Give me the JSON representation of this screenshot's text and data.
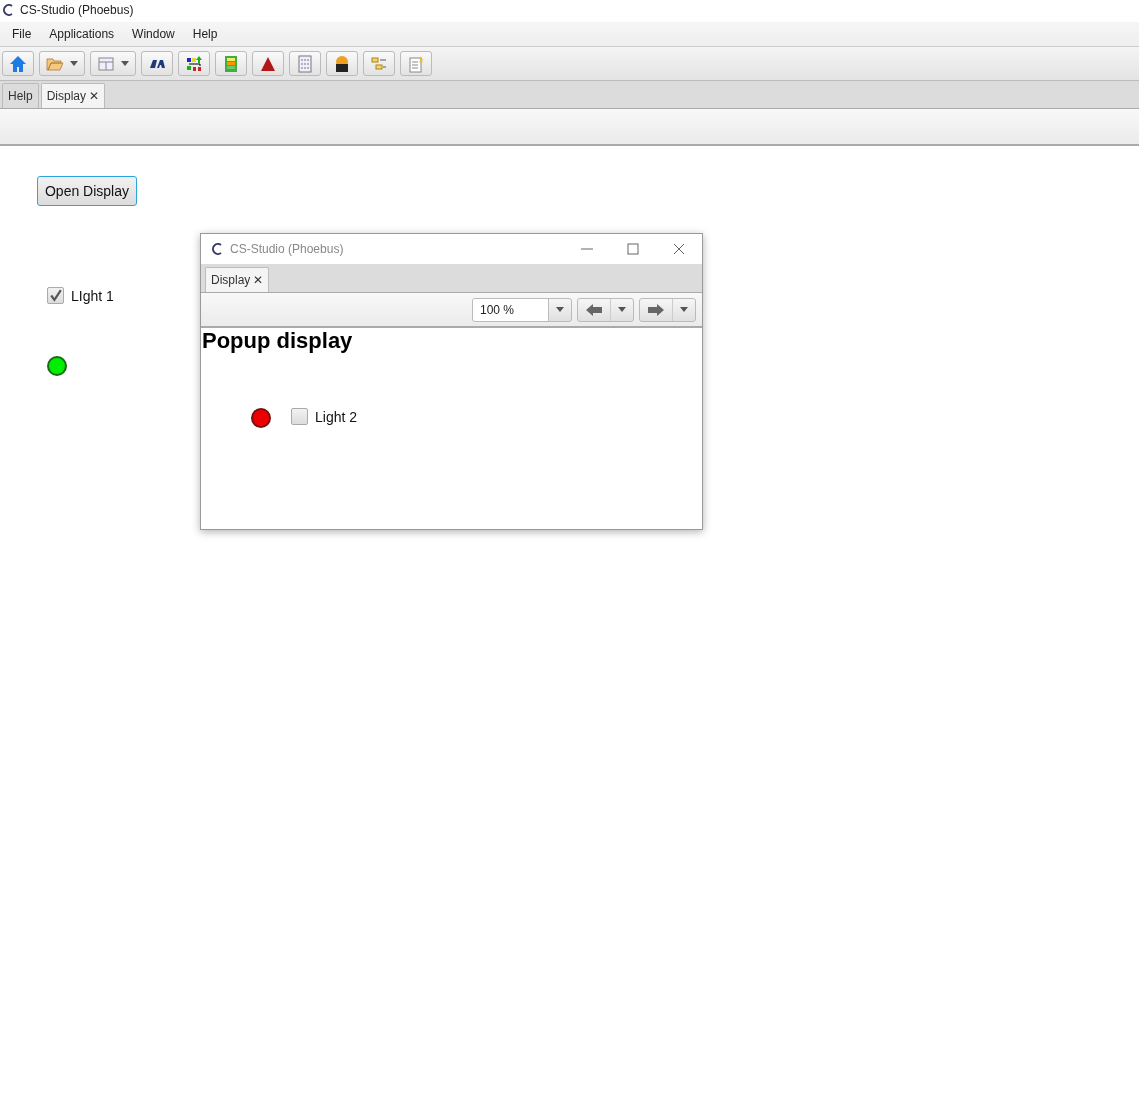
{
  "window": {
    "title": "CS-Studio (Phoebus)"
  },
  "menu": [
    "File",
    "Applications",
    "Window",
    "Help"
  ],
  "toolbar": [
    {
      "kind": "home",
      "dropdown": false
    },
    {
      "kind": "folder",
      "dropdown": true
    },
    {
      "kind": "layout",
      "dropdown": true
    },
    {
      "kind": "tia",
      "dropdown": false
    },
    {
      "kind": "network",
      "dropdown": false
    },
    {
      "kind": "table",
      "dropdown": false
    },
    {
      "kind": "triangle",
      "dropdown": false
    },
    {
      "kind": "list",
      "dropdown": false
    },
    {
      "kind": "badge",
      "dropdown": false
    },
    {
      "kind": "tree",
      "dropdown": false
    },
    {
      "kind": "note",
      "dropdown": false
    }
  ],
  "tabs": [
    {
      "label": "Help",
      "selected": false,
      "closable": false
    },
    {
      "label": "Display",
      "selected": true,
      "closable": true
    }
  ],
  "close_glyph": "✕",
  "display": {
    "button": "Open Display",
    "checkbox": {
      "label": "LIght 1",
      "checked": true
    },
    "led": {
      "on": true
    }
  },
  "popup": {
    "title": "CS-Studio (Phoebus)",
    "tab": {
      "label": "Display",
      "selected": true
    },
    "zoom": "100 %",
    "heading": "Popup display",
    "led": {
      "on": false
    },
    "checkbox": {
      "label": "Light 2",
      "checked": false
    }
  }
}
